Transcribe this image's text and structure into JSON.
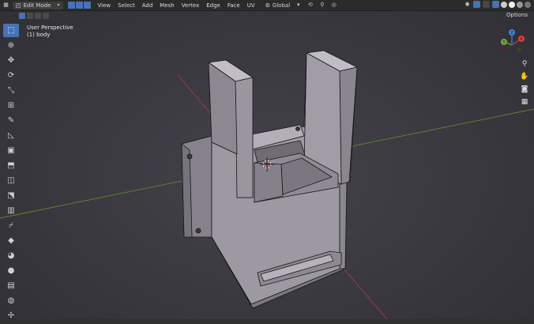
{
  "header": {
    "mode_label": "Edit Mode",
    "menu": [
      "View",
      "Select",
      "Add",
      "Mesh",
      "Vertex",
      "Edge",
      "Face",
      "UV"
    ],
    "orientation_label": "Global",
    "options_label": "Options"
  },
  "viewport": {
    "perspective_label": "User Perspective",
    "object_label": "(1) body"
  },
  "toolbar_tools": [
    "select-box",
    "cursor",
    "move",
    "rotate",
    "scale",
    "transform",
    "annotate",
    "measure",
    "add-cube",
    "extrude",
    "inset",
    "bevel",
    "loop-cut",
    "knife",
    "poly-build",
    "spin",
    "smooth",
    "edge-slide",
    "shrink-fatten",
    "shear",
    "rip"
  ],
  "gizmo": {
    "x": "X",
    "y": "Y",
    "z": "Z"
  },
  "colors": {
    "accent": "#4772b3",
    "axis_red": "#a53a3a",
    "axis_green": "#5d8a2c",
    "mesh_face": "#a29ea8",
    "mesh_edge": "#1a1a1a"
  }
}
